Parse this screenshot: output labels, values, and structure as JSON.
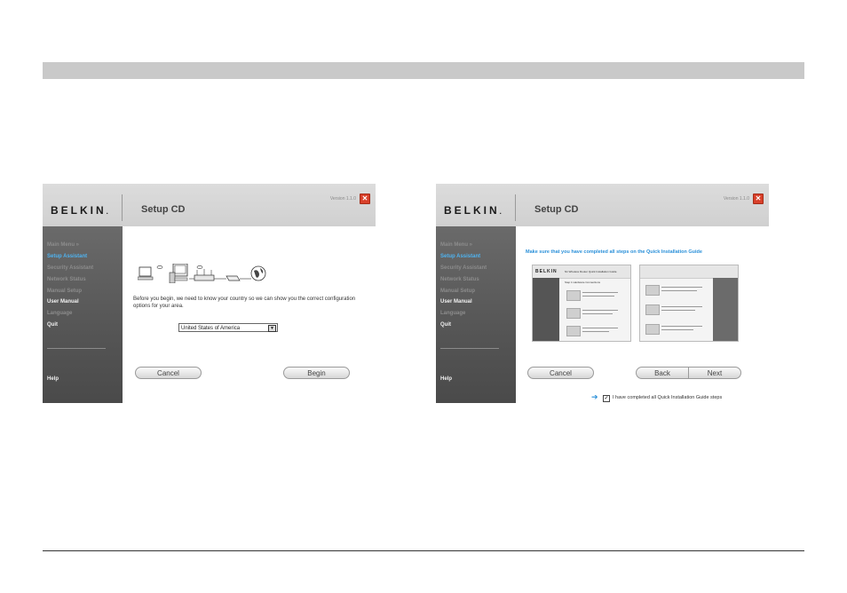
{
  "common": {
    "logo_text": "BELKIN",
    "logo_suffix": ".",
    "title": "Setup CD",
    "version": "Version 1.1.0",
    "sidebar": {
      "items": [
        "Main Menu  »",
        "Setup Assistant",
        "Security Assistant",
        "Network Status",
        "Manual Setup",
        "User Manual",
        "Language",
        "Quit"
      ],
      "help": "Help"
    }
  },
  "window_left": {
    "paragraph": "Before you begin, we need to know your country so we can show you the correct configuration options for your area.",
    "country_select": "United States of America",
    "cancel": "Cancel",
    "begin": "Begin"
  },
  "window_right": {
    "heading": "Make sure that you have completed all steps on the Quick Installation Guide",
    "guide_logo": "BELKIN",
    "guide_title": "N1 Wireless Router   Quick Installation Guide",
    "guide_step": "Step 1  Hardware Connections",
    "confirm_label": "I have completed all Quick Installation Guide steps",
    "checkbox_checked": true,
    "cancel": "Cancel",
    "back": "Back",
    "next": "Next"
  },
  "colors": {
    "accent_blue": "#4fb3f0",
    "close_red": "#d9402a",
    "sidebar_gray": "#5a5a5a",
    "header_gray": "#d4d4d4"
  }
}
